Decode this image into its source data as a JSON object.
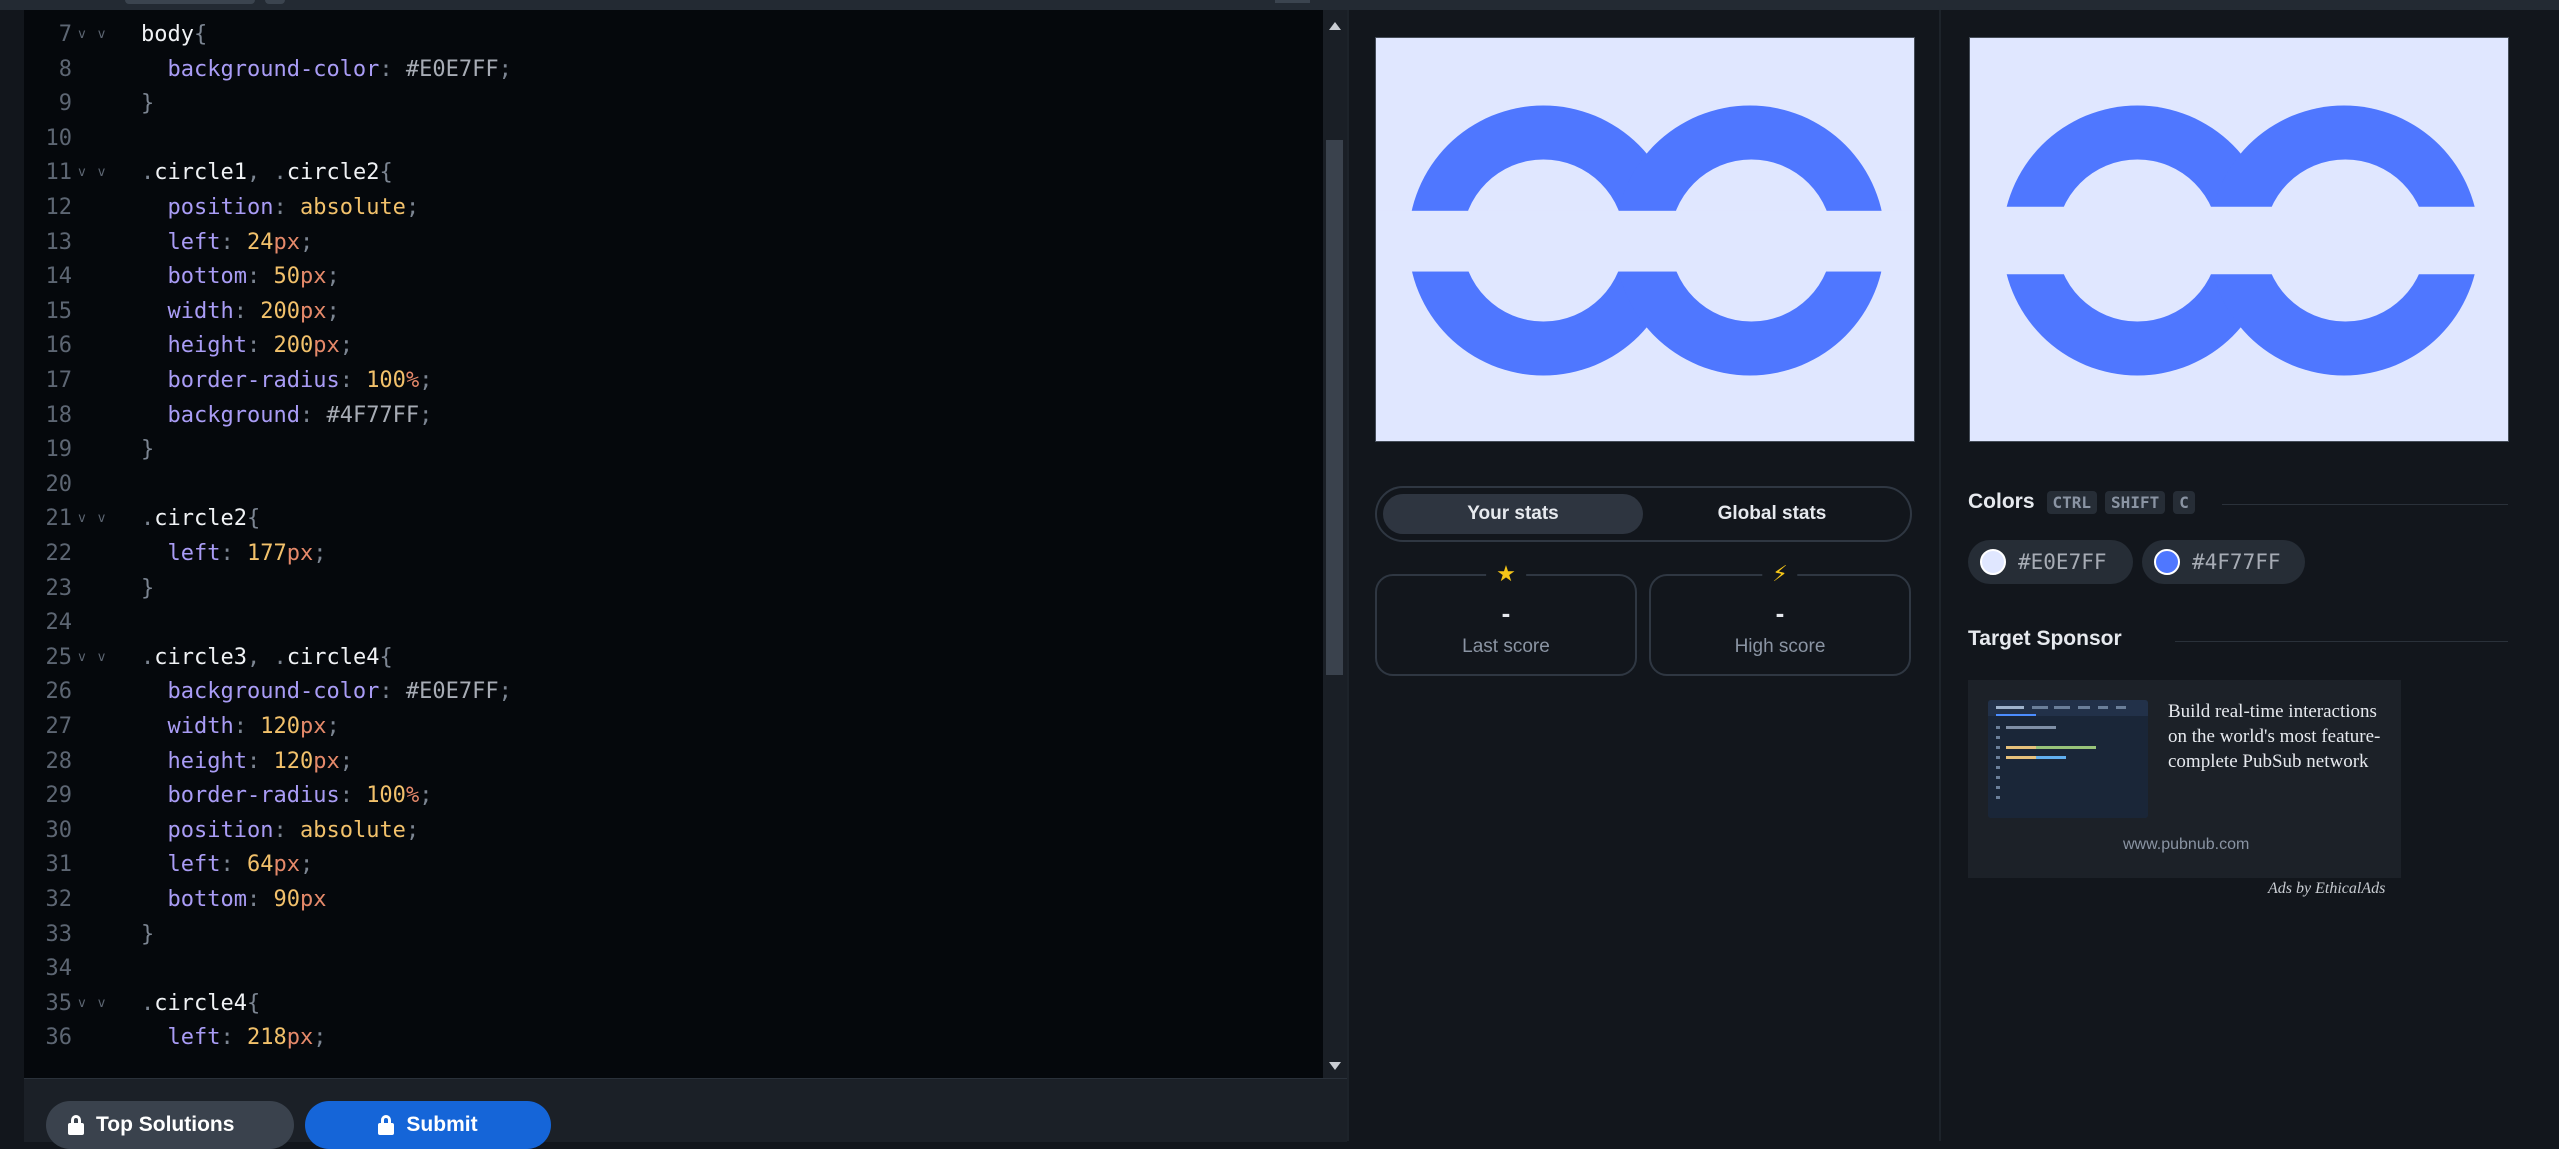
{
  "editor": {
    "lines": [
      {
        "n": "7",
        "fold": true,
        "tokens": [
          [
            "sel",
            "body"
          ],
          [
            "punc",
            "{"
          ]
        ]
      },
      {
        "n": "8",
        "fold": false,
        "tokens": [
          [
            "plain",
            "  "
          ],
          [
            "prop",
            "background-color"
          ],
          [
            "punc",
            ": "
          ],
          [
            "hex",
            "#E0E7FF"
          ],
          [
            "punc",
            ";"
          ]
        ]
      },
      {
        "n": "9",
        "fold": false,
        "tokens": [
          [
            "punc",
            "}"
          ]
        ]
      },
      {
        "n": "10",
        "fold": false,
        "tokens": []
      },
      {
        "n": "11",
        "fold": true,
        "tokens": [
          [
            "punc",
            "."
          ],
          [
            "sel",
            "circle1"
          ],
          [
            "punc",
            ", ."
          ],
          [
            "sel",
            "circle2"
          ],
          [
            "punc",
            "{"
          ]
        ]
      },
      {
        "n": "12",
        "fold": false,
        "tokens": [
          [
            "plain",
            "  "
          ],
          [
            "prop",
            "position"
          ],
          [
            "punc",
            ": "
          ],
          [
            "val",
            "absolute"
          ],
          [
            "punc",
            ";"
          ]
        ]
      },
      {
        "n": "13",
        "fold": false,
        "tokens": [
          [
            "plain",
            "  "
          ],
          [
            "prop",
            "left"
          ],
          [
            "punc",
            ": "
          ],
          [
            "num",
            "24"
          ],
          [
            "unit",
            "px"
          ],
          [
            "punc",
            ";"
          ]
        ]
      },
      {
        "n": "14",
        "fold": false,
        "tokens": [
          [
            "plain",
            "  "
          ],
          [
            "prop",
            "bottom"
          ],
          [
            "punc",
            ": "
          ],
          [
            "num",
            "50"
          ],
          [
            "unit",
            "px"
          ],
          [
            "punc",
            ";"
          ]
        ]
      },
      {
        "n": "15",
        "fold": false,
        "tokens": [
          [
            "plain",
            "  "
          ],
          [
            "prop",
            "width"
          ],
          [
            "punc",
            ": "
          ],
          [
            "num",
            "200"
          ],
          [
            "unit",
            "px"
          ],
          [
            "punc",
            ";"
          ]
        ]
      },
      {
        "n": "16",
        "fold": false,
        "tokens": [
          [
            "plain",
            "  "
          ],
          [
            "prop",
            "height"
          ],
          [
            "punc",
            ": "
          ],
          [
            "num",
            "200"
          ],
          [
            "unit",
            "px"
          ],
          [
            "punc",
            ";"
          ]
        ]
      },
      {
        "n": "17",
        "fold": false,
        "tokens": [
          [
            "plain",
            "  "
          ],
          [
            "prop",
            "border-radius"
          ],
          [
            "punc",
            ": "
          ],
          [
            "num",
            "100"
          ],
          [
            "unit",
            "%"
          ],
          [
            "punc",
            ";"
          ]
        ]
      },
      {
        "n": "18",
        "fold": false,
        "tokens": [
          [
            "plain",
            "  "
          ],
          [
            "prop",
            "background"
          ],
          [
            "punc",
            ": "
          ],
          [
            "hex",
            "#4F77FF"
          ],
          [
            "punc",
            ";"
          ]
        ]
      },
      {
        "n": "19",
        "fold": false,
        "tokens": [
          [
            "punc",
            "}"
          ]
        ]
      },
      {
        "n": "20",
        "fold": false,
        "tokens": []
      },
      {
        "n": "21",
        "fold": true,
        "tokens": [
          [
            "punc",
            "."
          ],
          [
            "sel",
            "circle2"
          ],
          [
            "punc",
            "{"
          ]
        ]
      },
      {
        "n": "22",
        "fold": false,
        "tokens": [
          [
            "plain",
            "  "
          ],
          [
            "prop",
            "left"
          ],
          [
            "punc",
            ": "
          ],
          [
            "num",
            "177"
          ],
          [
            "unit",
            "px"
          ],
          [
            "punc",
            ";"
          ]
        ]
      },
      {
        "n": "23",
        "fold": false,
        "tokens": [
          [
            "punc",
            "}"
          ]
        ]
      },
      {
        "n": "24",
        "fold": false,
        "tokens": []
      },
      {
        "n": "25",
        "fold": true,
        "tokens": [
          [
            "punc",
            "."
          ],
          [
            "sel",
            "circle3"
          ],
          [
            "punc",
            ", ."
          ],
          [
            "sel",
            "circle4"
          ],
          [
            "punc",
            "{"
          ]
        ]
      },
      {
        "n": "26",
        "fold": false,
        "tokens": [
          [
            "plain",
            "  "
          ],
          [
            "prop",
            "background-color"
          ],
          [
            "punc",
            ": "
          ],
          [
            "hex",
            "#E0E7FF"
          ],
          [
            "punc",
            ";"
          ]
        ]
      },
      {
        "n": "27",
        "fold": false,
        "tokens": [
          [
            "plain",
            "  "
          ],
          [
            "prop",
            "width"
          ],
          [
            "punc",
            ": "
          ],
          [
            "num",
            "120"
          ],
          [
            "unit",
            "px"
          ],
          [
            "punc",
            ";"
          ]
        ]
      },
      {
        "n": "28",
        "fold": false,
        "tokens": [
          [
            "plain",
            "  "
          ],
          [
            "prop",
            "height"
          ],
          [
            "punc",
            ": "
          ],
          [
            "num",
            "120"
          ],
          [
            "unit",
            "px"
          ],
          [
            "punc",
            ";"
          ]
        ]
      },
      {
        "n": "29",
        "fold": false,
        "tokens": [
          [
            "plain",
            "  "
          ],
          [
            "prop",
            "border-radius"
          ],
          [
            "punc",
            ": "
          ],
          [
            "num",
            "100"
          ],
          [
            "unit",
            "%"
          ],
          [
            "punc",
            ";"
          ]
        ]
      },
      {
        "n": "30",
        "fold": false,
        "tokens": [
          [
            "plain",
            "  "
          ],
          [
            "prop",
            "position"
          ],
          [
            "punc",
            ": "
          ],
          [
            "val",
            "absolute"
          ],
          [
            "punc",
            ";"
          ]
        ]
      },
      {
        "n": "31",
        "fold": false,
        "tokens": [
          [
            "plain",
            "  "
          ],
          [
            "prop",
            "left"
          ],
          [
            "punc",
            ": "
          ],
          [
            "num",
            "64"
          ],
          [
            "unit",
            "px"
          ],
          [
            "punc",
            ";"
          ]
        ]
      },
      {
        "n": "32",
        "fold": false,
        "tokens": [
          [
            "plain",
            "  "
          ],
          [
            "prop",
            "bottom"
          ],
          [
            "punc",
            ": "
          ],
          [
            "num",
            "90"
          ],
          [
            "unit",
            "px"
          ]
        ]
      },
      {
        "n": "33",
        "fold": false,
        "tokens": [
          [
            "punc",
            "}"
          ]
        ]
      },
      {
        "n": "34",
        "fold": false,
        "tokens": []
      },
      {
        "n": "35",
        "fold": true,
        "tokens": [
          [
            "punc",
            "."
          ],
          [
            "sel",
            "circle4"
          ],
          [
            "punc",
            "{"
          ]
        ]
      },
      {
        "n": "36",
        "fold": false,
        "tokens": [
          [
            "plain",
            "  "
          ],
          [
            "prop",
            "left"
          ],
          [
            "punc",
            ": "
          ],
          [
            "num",
            "218"
          ],
          [
            "unit",
            "px"
          ],
          [
            "punc",
            ";"
          ]
        ]
      }
    ]
  },
  "bottom": {
    "solutions_label": "Top Solutions",
    "submit_label": "Submit"
  },
  "stats": {
    "tabs": [
      "Your stats",
      "Global stats"
    ],
    "last_score_value": "-",
    "last_score_label": "Last score",
    "high_score_value": "-",
    "high_score_label": "High score"
  },
  "colors": {
    "title": "Colors",
    "shortcut": [
      "CTRL",
      "SHIFT",
      "C"
    ],
    "items": [
      {
        "hex": "#E0E7FF"
      },
      {
        "hex": "#4F77FF"
      }
    ]
  },
  "sponsor": {
    "title": "Target Sponsor",
    "ad_text": "Build real-time interactions on the world's most feature-complete PubSub network",
    "url": "www.pubnub.com",
    "ads_by": "Ads by EthicalAds"
  },
  "theme": {
    "preview_bg": "#E0E7FF",
    "shape_color": "#4F77FF",
    "submit_color": "#1565D8"
  }
}
